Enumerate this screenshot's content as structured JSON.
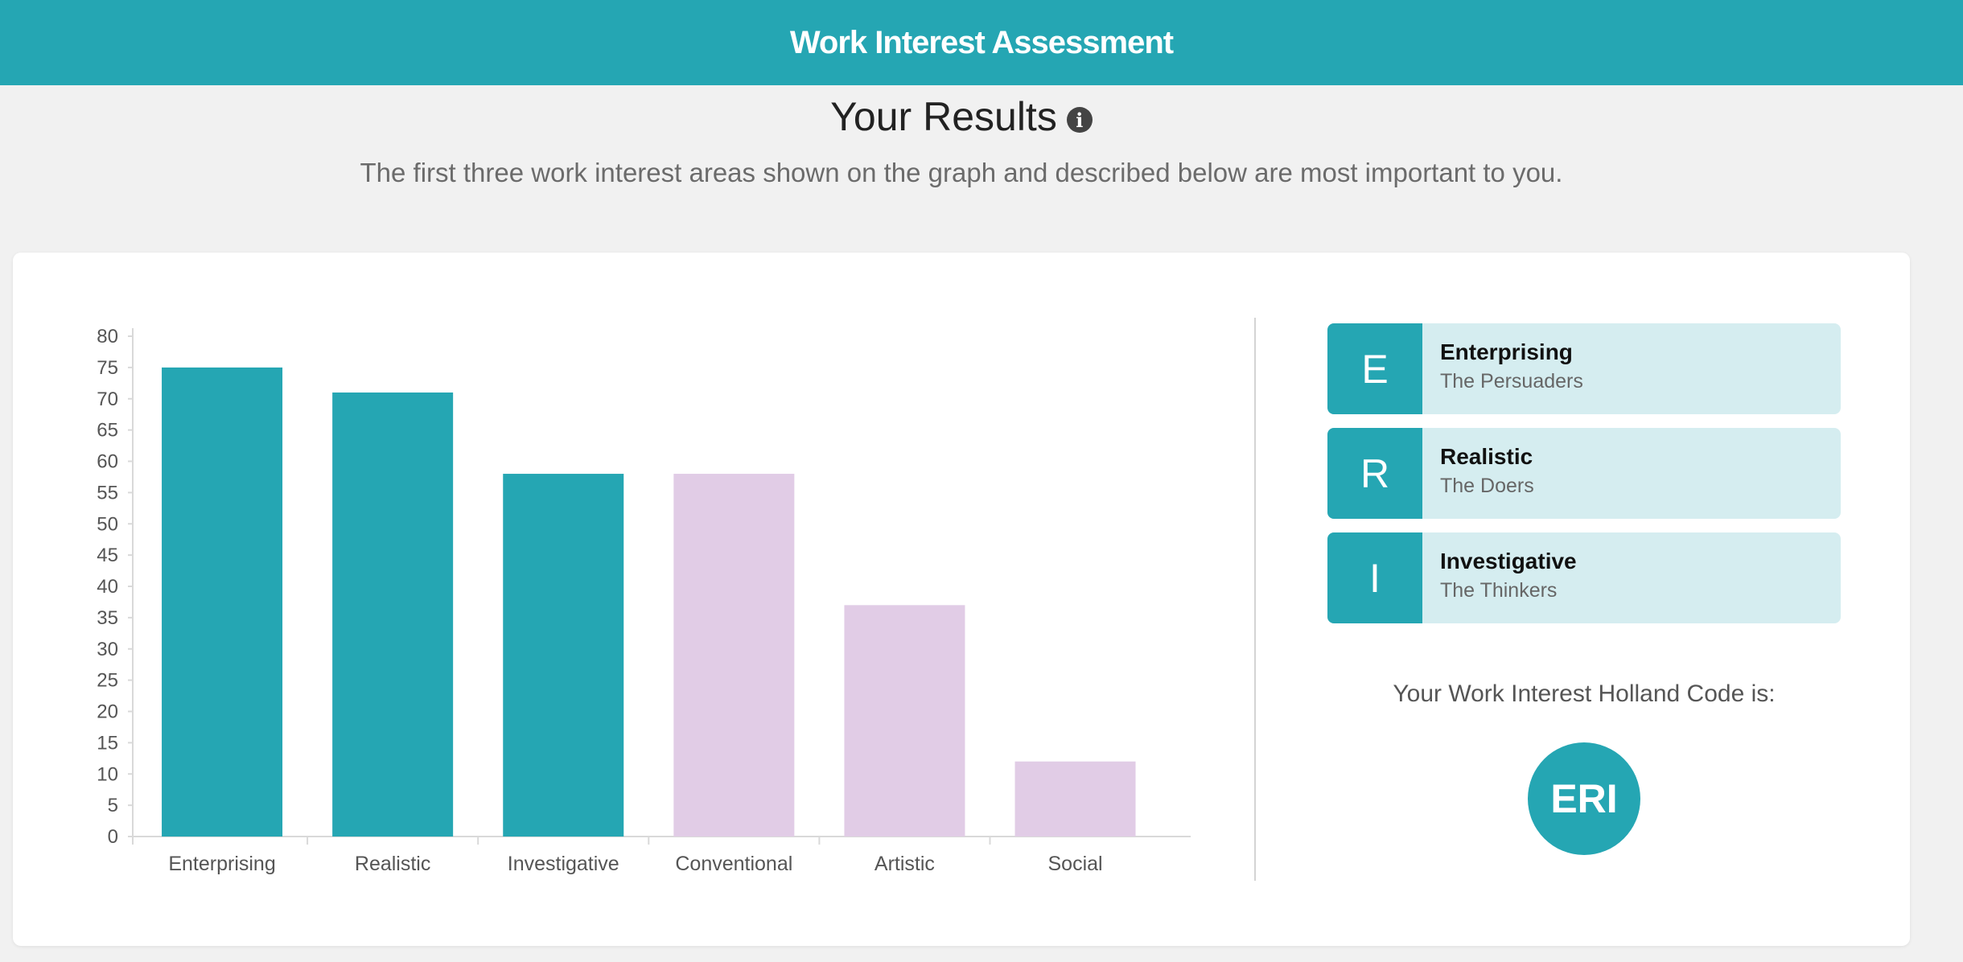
{
  "header": {
    "title": "Work Interest Assessment"
  },
  "results": {
    "title": "Your Results",
    "info_icon": "info-circle-icon",
    "subtitle": "The first three work interest areas shown on the graph and described below are most important to you."
  },
  "chart_data": {
    "type": "bar",
    "categories": [
      "Enterprising",
      "Realistic",
      "Investigative",
      "Conventional",
      "Artistic",
      "Social"
    ],
    "values": [
      75,
      71,
      58,
      58,
      37,
      12
    ],
    "ylim": [
      0,
      80
    ],
    "yticks": [
      0,
      5,
      10,
      15,
      20,
      25,
      30,
      35,
      40,
      45,
      50,
      55,
      60,
      65,
      70,
      75,
      80
    ],
    "colors": [
      "#25a6b3",
      "#25a6b3",
      "#25a6b3",
      "#e1cce6",
      "#e1cce6",
      "#e1cce6"
    ],
    "grid": false,
    "xlabel": "",
    "ylabel": ""
  },
  "top_codes": [
    {
      "letter": "E",
      "name": "Enterprising",
      "description": "The Persuaders"
    },
    {
      "letter": "R",
      "name": "Realistic",
      "description": "The Doers"
    },
    {
      "letter": "I",
      "name": "Investigative",
      "description": "The Thinkers"
    }
  ],
  "holland": {
    "label": "Your Work Interest Holland Code is:",
    "code": "ERI"
  },
  "colors": {
    "accent": "#25a6b3",
    "muted_bar": "#e1cce6",
    "code_bg": "#d5edf0"
  }
}
